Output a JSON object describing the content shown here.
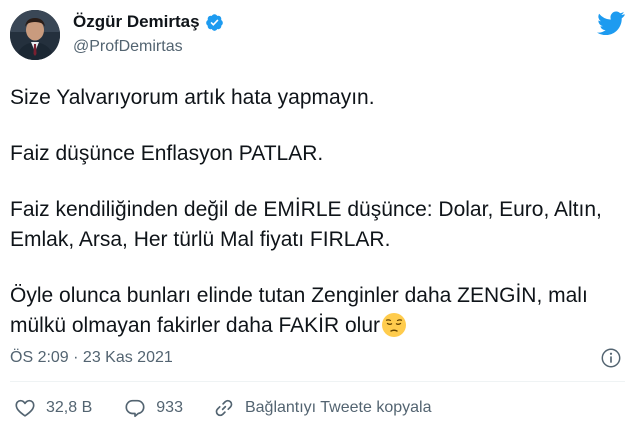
{
  "author": {
    "display_name": "Özgür Demirtaş",
    "handle": "@ProfDemirtas",
    "verified": true
  },
  "icons": {
    "avatar": "avatar-photo",
    "verified": "verified-badge-icon",
    "brand": "twitter-bird-icon",
    "info": "info-icon",
    "like": "heart-icon",
    "reply": "reply-bubble-icon",
    "link": "link-icon",
    "emoji": "pensive-face-emoji"
  },
  "colors": {
    "brand_blue": "#1d9bf0",
    "text_primary": "#0f1419",
    "text_secondary": "#536471"
  },
  "tweet": {
    "paragraphs": [
      "Size Yalvarıyorum artık hata yapmayın.",
      "Faiz düşünce Enflasyon PATLAR.",
      "Faiz kendiliğinden değil de EMİRLE düşünce: Dolar, Euro, Altın, Emlak, Arsa, Her türlü Mal fiyatı FIRLAR.",
      "Öyle olunca bunları elinde tutan Zenginler daha ZENGİN, malı mülkü olmayan fakirler daha FAKİR olur"
    ],
    "timestamp": "ÖS 2:09 · 23 Kas 2021"
  },
  "actions": {
    "likes": "32,8 B",
    "replies": "933",
    "copy_link": "Bağlantıyı Tweete kopyala"
  }
}
